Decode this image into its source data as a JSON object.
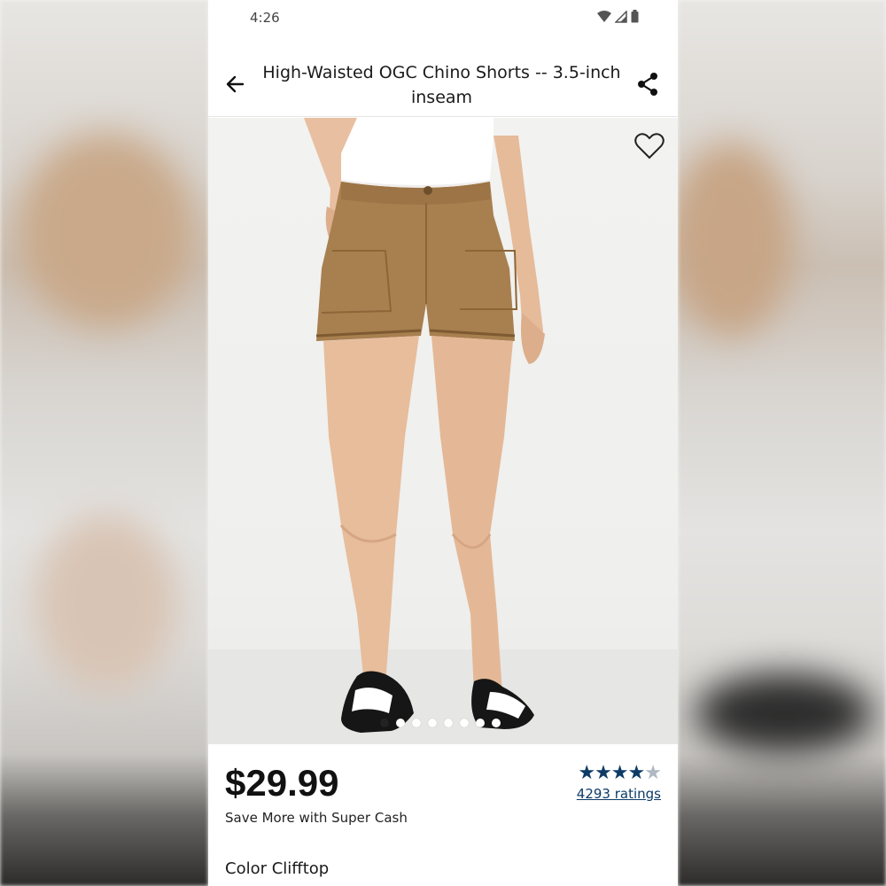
{
  "status_bar": {
    "time": "4:26"
  },
  "header": {
    "title": "High-Waisted OGC Chino Shorts -- 3.5-inch inseam",
    "back_icon": "arrow-left-icon",
    "share_icon": "share-icon"
  },
  "gallery": {
    "image_alt": "product-photo",
    "total_slides": 8,
    "active_slide": 1,
    "favorite_icon": "heart-outline-icon"
  },
  "product": {
    "price": "$29.99",
    "promo": "Save More with Super Cash",
    "rating_value": 4.5,
    "rating_count_label": "4293 ratings",
    "color_label": "Color Clifftop"
  },
  "colors": {
    "rating_blue": "#0d3b66",
    "shorts_tan": "#a87f4f"
  }
}
